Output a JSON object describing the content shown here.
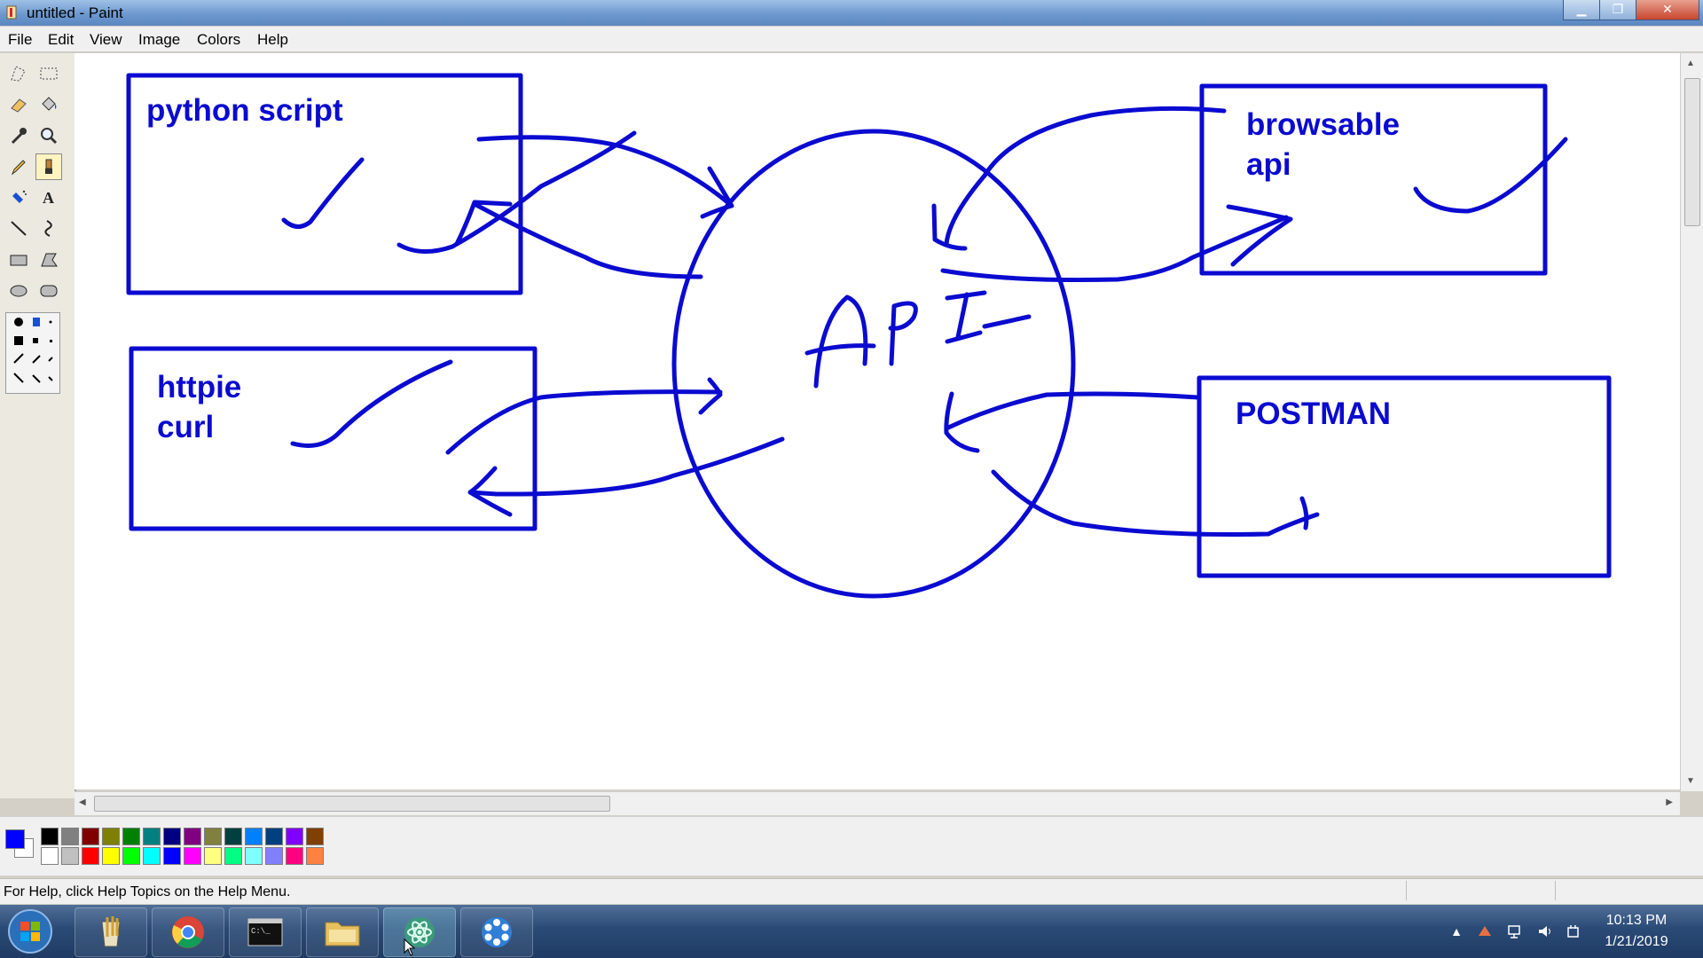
{
  "window": {
    "title": "untitled - Paint"
  },
  "menubar": {
    "items": [
      "File",
      "Edit",
      "View",
      "Image",
      "Colors",
      "Help"
    ]
  },
  "canvas": {
    "ink_color": "#0a0ad0",
    "boxes": {
      "python_script": "python script",
      "httpie": "httpie",
      "curl": "curl",
      "browsable": "browsable",
      "api": "api",
      "postman": "POSTMAN"
    },
    "center_label": "API"
  },
  "palette": {
    "primary": "#0000ff",
    "secondary": "#ffffff",
    "row1": [
      "#000000",
      "#808080",
      "#800000",
      "#808000",
      "#008000",
      "#008080",
      "#000080",
      "#800080",
      "#808040",
      "#004040",
      "#0080ff",
      "#004080",
      "#8000ff",
      "#804000"
    ],
    "row2": [
      "#ffffff",
      "#c0c0c0",
      "#ff0000",
      "#ffff00",
      "#00ff00",
      "#00ffff",
      "#0000ff",
      "#ff00ff",
      "#ffff80",
      "#00ff80",
      "#80ffff",
      "#8080ff",
      "#ff0080",
      "#ff8040"
    ]
  },
  "status": {
    "text": "For Help, click Help Topics on the Help Menu."
  },
  "taskbar": {
    "apps": [
      "paint",
      "chrome",
      "command-prompt",
      "file-explorer",
      "atom",
      "settings"
    ],
    "clock": {
      "time": "10:13 PM",
      "date": "1/21/2019"
    }
  }
}
